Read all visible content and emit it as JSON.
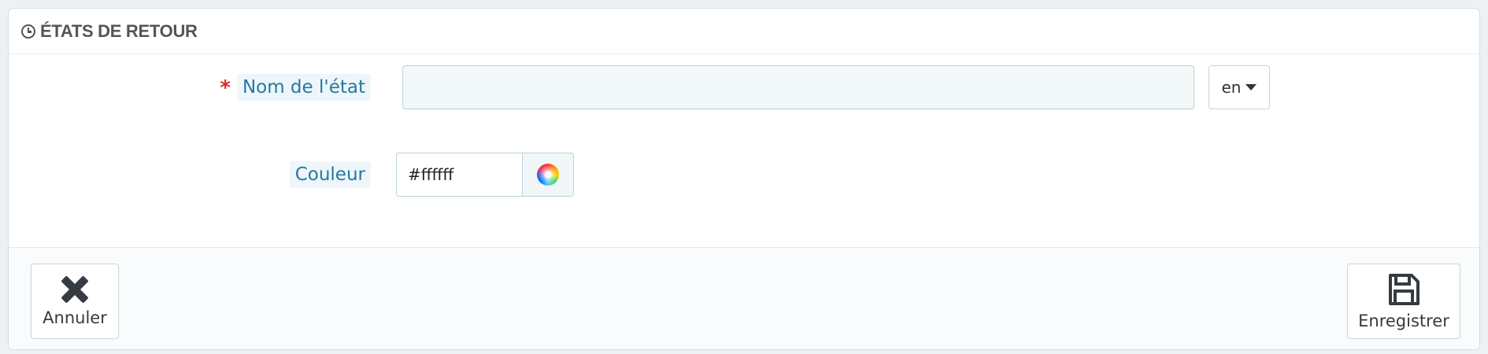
{
  "panel": {
    "title": "ÉTATS DE RETOUR",
    "title_icon": "clock-icon"
  },
  "form": {
    "name_field": {
      "required_mark": "*",
      "label": "Nom de l'état",
      "value": "",
      "language": "en"
    },
    "color_field": {
      "label": "Couleur",
      "value": "#ffffff",
      "picker_icon": "color-wheel-icon"
    }
  },
  "footer": {
    "cancel_label": "Annuler",
    "save_label": "Enregistrer"
  },
  "colors": {
    "label_text": "#25799f",
    "required": "#e32b25",
    "input_bg": "#f3f8f9"
  }
}
